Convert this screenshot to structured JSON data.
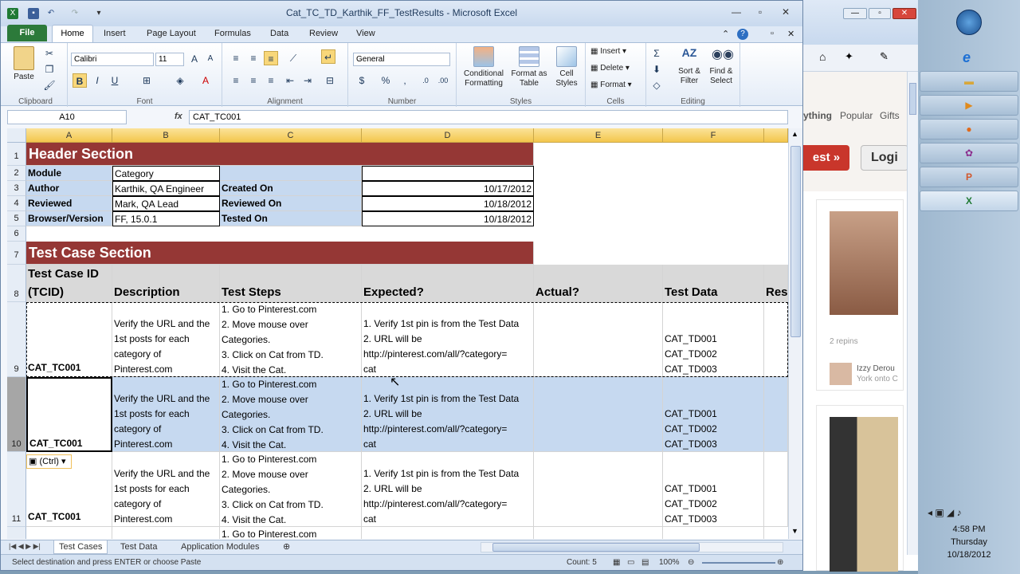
{
  "window": {
    "title": "Cat_TC_TD_Karthik_FF_TestResults - Microsoft Excel"
  },
  "ribbon_tabs": [
    "File",
    "Home",
    "Insert",
    "Page Layout",
    "Formulas",
    "Data",
    "Review",
    "View"
  ],
  "ribbon": {
    "clipboard": {
      "label": "Clipboard",
      "paste": "Paste"
    },
    "font": {
      "label": "Font",
      "name": "Calibri",
      "size": "11"
    },
    "alignment": {
      "label": "Alignment"
    },
    "number": {
      "label": "Number",
      "format": "General",
      "currency": "$",
      "percent": "%",
      "comma": ","
    },
    "styles": {
      "label": "Styles",
      "conditional": "Conditional Formatting",
      "format_table": "Format as Table",
      "cell_styles": "Cell Styles"
    },
    "cells": {
      "label": "Cells",
      "insert": "Insert",
      "delete": "Delete",
      "format": "Format"
    },
    "editing": {
      "label": "Editing",
      "sort": "Sort & Filter",
      "find": "Find & Select"
    }
  },
  "namebox": "A10",
  "fx": "fx",
  "formula": "CAT_TC001",
  "columns": [
    "A",
    "B",
    "C",
    "D",
    "E",
    "F"
  ],
  "rows": {
    "r1": "Header Section",
    "r2": {
      "a": "Module",
      "b": "Category"
    },
    "r3": {
      "a": "Author",
      "b": "Karthik, QA Engineer",
      "c": "Created On",
      "d": "10/17/2012"
    },
    "r4": {
      "a": "Reviewed",
      "b": "Mark, QA Lead",
      "c": "Reviewed On",
      "d": "10/18/2012"
    },
    "r5": {
      "a": "Browser/Version",
      "b": "FF, 15.0.1",
      "c": "Tested On",
      "d": "10/18/2012"
    },
    "r7": "Test Case Section",
    "r8": {
      "a1": "Test Case ID",
      "a2": "(TCID)",
      "b": "Description",
      "c": "Test Steps",
      "d": "Expected?",
      "e": "Actual?",
      "f": "Test Data",
      "g": "Res"
    },
    "tc": {
      "id": "CAT_TC001",
      "desc": [
        "Verify the URL and the",
        "1st posts for each",
        "category of",
        "Pinterest.com"
      ],
      "steps": [
        "1. Go to Pinterest.com",
        "2. Move mouse over",
        "Categories.",
        "3. Click on Cat from TD.",
        "4. Visit the Cat."
      ],
      "expected": [
        "1. Verify 1st pin is from the Test Data",
        "2. URL will be",
        "http://pinterest.com/all/?category=",
        "cat"
      ],
      "data": [
        "CAT_TD001",
        "CAT_TD002",
        "CAT_TD003"
      ]
    },
    "r12_step": "1. Go to Pinterest.com"
  },
  "row_numbers": [
    "1",
    "2",
    "3",
    "4",
    "5",
    "6",
    "7",
    "8",
    "9",
    "10",
    "11"
  ],
  "paste_tag": "(Ctrl)",
  "sheets": [
    "Test Cases",
    "Test Data",
    "Application Modules"
  ],
  "status": {
    "message": "Select destination and press ENTER or choose Paste",
    "count": "Count: 5",
    "zoom": "100%"
  },
  "browser": {
    "nav1": "ything",
    "nav2": "Popular",
    "nav3": "Gifts",
    "test_btn": "est »",
    "login_btn": "Logi",
    "repins": "2 repins",
    "user": "Izzy Derou",
    "user2": "York onto C"
  },
  "clock": {
    "time": "4:58 PM",
    "day": "Thursday",
    "date": "10/18/2012"
  }
}
